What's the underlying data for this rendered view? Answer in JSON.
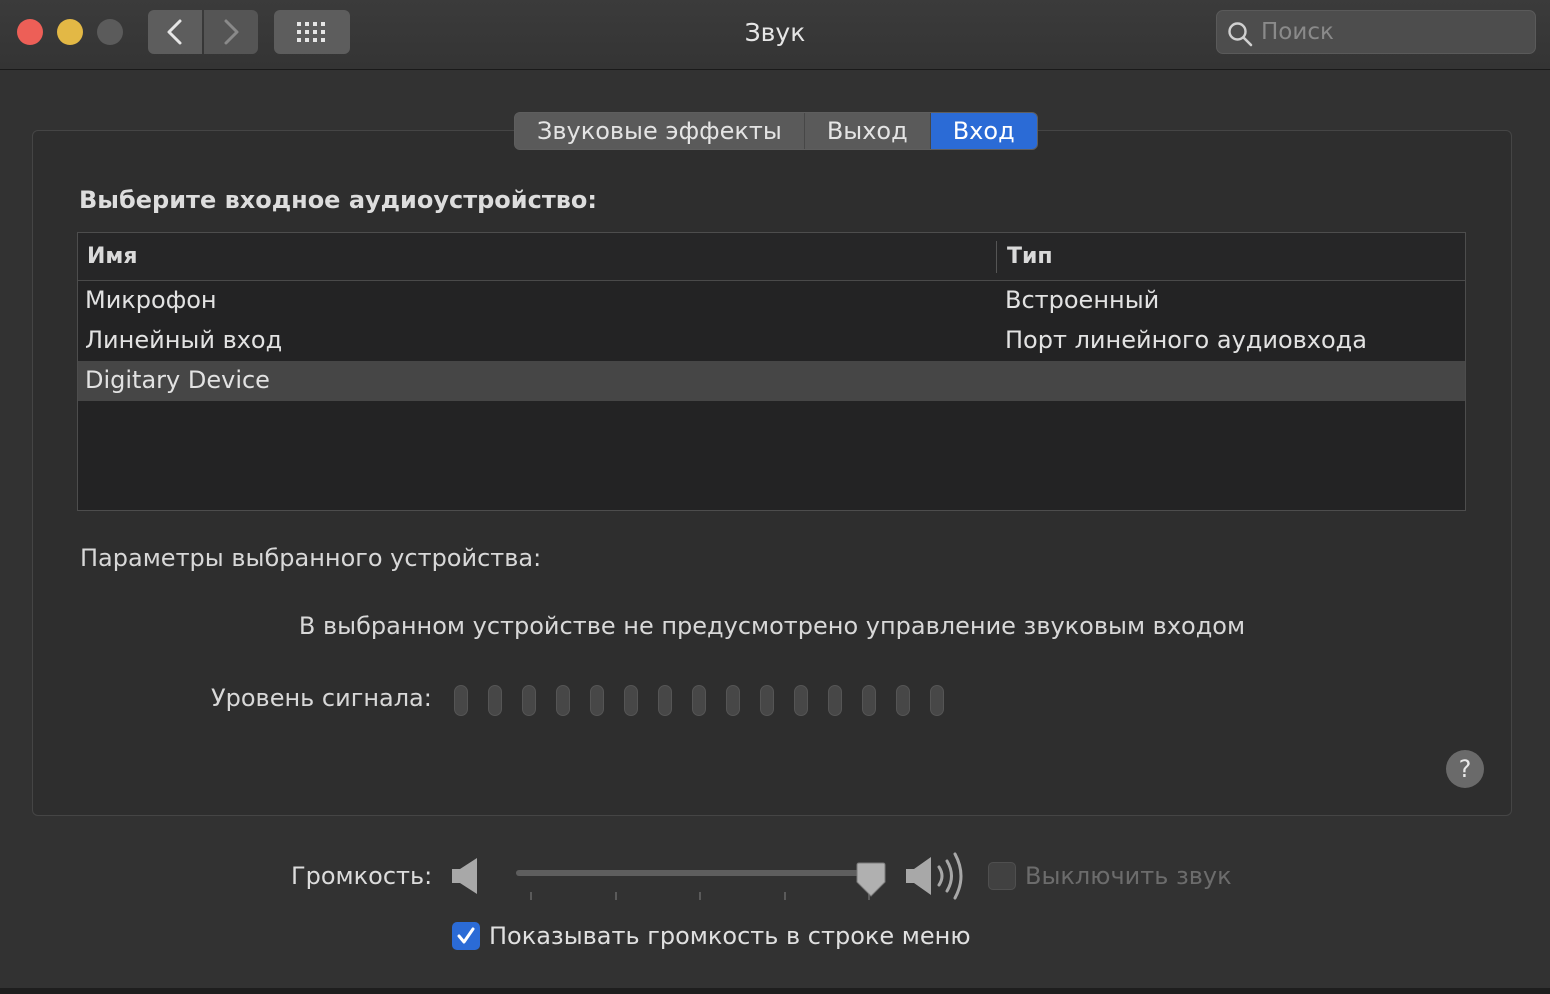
{
  "window": {
    "title": "Звук"
  },
  "toolbar": {
    "back_icon": "chevron-left-icon",
    "forward_icon": "chevron-right-icon",
    "grid_icon": "grid-icon"
  },
  "search": {
    "placeholder": "Поиск",
    "value": ""
  },
  "tabs": [
    {
      "label": "Звуковые эффекты",
      "active": false
    },
    {
      "label": "Выход",
      "active": false
    },
    {
      "label": "Вход",
      "active": true
    }
  ],
  "input": {
    "heading": "Выберите входное аудиоустройство:",
    "columns": {
      "name": "Имя",
      "type": "Тип"
    },
    "devices": [
      {
        "name": "Микрофон",
        "type": "Встроенный",
        "selected": false
      },
      {
        "name": "Линейный вход",
        "type": "Порт линейного аудиовхода",
        "selected": false
      },
      {
        "name": "Digitary Device",
        "type": "",
        "selected": true
      }
    ],
    "params_label": "Параметры выбранного устройства:",
    "no_control_message": "В выбранном устройстве не предусмотрено управление звуковым входом",
    "level_label": "Уровень сигнала:",
    "level_segments": 15,
    "level_active_segments": 0
  },
  "help": {
    "label": "?"
  },
  "volume": {
    "label": "Громкость:",
    "level": 1.0,
    "mute_label": "Выключить звук",
    "mute_checked": false,
    "show_in_menu_label": "Показывать громкость в строке меню",
    "show_in_menu_checked": true
  },
  "colors": {
    "accent": "#2b6bd6",
    "close": "#ed5f57",
    "minimize": "#e3b845",
    "zoom_disabled": "#5b5b5b"
  }
}
